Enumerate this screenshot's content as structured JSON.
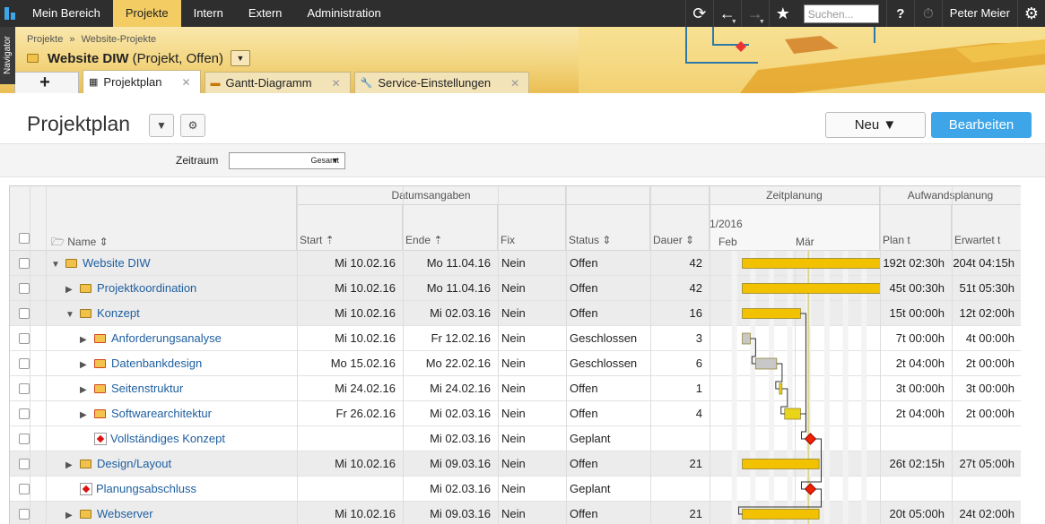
{
  "topbar": {
    "menu": [
      "Mein Bereich",
      "Projekte",
      "Intern",
      "Extern",
      "Administration"
    ],
    "active_index": 1,
    "search_placeholder": "Suchen...",
    "user": "Peter Meier"
  },
  "navigator_label": "Navigator",
  "breadcrumb": {
    "items": [
      "Projekte",
      "Website-Projekte"
    ],
    "sep": "»"
  },
  "project": {
    "name": "Website DIW",
    "meta": "(Projekt, Offen)"
  },
  "tabs": [
    {
      "label": "Projektplan",
      "active": true
    },
    {
      "label": "Gantt-Diagramm",
      "active": false
    },
    {
      "label": "Service-Einstellungen",
      "active": false
    }
  ],
  "page": {
    "title": "Projektplan",
    "new_label": "Neu",
    "edit_label": "Bearbeiten"
  },
  "filter": {
    "label": "Zeitraum",
    "value": "Gesamt"
  },
  "groups": {
    "dates": "Datumsangaben",
    "timeline": "Zeitplanung",
    "effort": "Aufwandsplanung"
  },
  "columns": {
    "name": "Name",
    "start": "Start",
    "end": "Ende",
    "fix": "Fix",
    "status": "Status",
    "duration": "Dauer",
    "plan": "Plan t",
    "expected": "Erwartet t"
  },
  "timeline": {
    "year": "1/2016",
    "months": [
      "Feb",
      "Mär"
    ]
  },
  "colors": {
    "accent": "#3ea6e8",
    "bar": "#f2c200",
    "header_gold": "#f3d57f",
    "link": "#1f5fa0"
  },
  "rows": [
    {
      "indent": 0,
      "expand": "down",
      "icon": "folder",
      "name": "Website DIW",
      "start": "Mi 10.02.16",
      "end": "Mo 11.04.16",
      "fix": "Nein",
      "status": "Offen",
      "duration": "42",
      "plan": "192t 02:30h",
      "expected": "204t 04:15h",
      "grey": true
    },
    {
      "indent": 1,
      "expand": "right",
      "icon": "folder",
      "name": "Projektkoordination",
      "start": "Mi 10.02.16",
      "end": "Mo 11.04.16",
      "fix": "Nein",
      "status": "Offen",
      "duration": "42",
      "plan": "45t 00:30h",
      "expected": "51t 05:30h",
      "grey": true
    },
    {
      "indent": 1,
      "expand": "down",
      "icon": "folder",
      "name": "Konzept",
      "start": "Mi 10.02.16",
      "end": "Mi 02.03.16",
      "fix": "Nein",
      "status": "Offen",
      "duration": "16",
      "plan": "15t 00:00h",
      "expected": "12t 02:00h",
      "grey": true
    },
    {
      "indent": 2,
      "expand": "right",
      "icon": "task",
      "name": "Anforderungsanalyse",
      "start": "Mi 10.02.16",
      "end": "Fr 12.02.16",
      "fix": "Nein",
      "status": "Geschlossen",
      "duration": "3",
      "plan": "7t 00:00h",
      "expected": "4t 00:00h",
      "grey": false
    },
    {
      "indent": 2,
      "expand": "right",
      "icon": "task",
      "name": "Datenbankdesign",
      "start": "Mo 15.02.16",
      "end": "Mo 22.02.16",
      "fix": "Nein",
      "status": "Geschlossen",
      "duration": "6",
      "plan": "2t 04:00h",
      "expected": "2t 00:00h",
      "grey": false
    },
    {
      "indent": 2,
      "expand": "right",
      "icon": "task",
      "name": "Seitenstruktur",
      "start": "Mi 24.02.16",
      "end": "Mi 24.02.16",
      "fix": "Nein",
      "status": "Offen",
      "duration": "1",
      "plan": "3t 00:00h",
      "expected": "3t 00:00h",
      "grey": false
    },
    {
      "indent": 2,
      "expand": "right",
      "icon": "task",
      "name": "Softwarearchitektur",
      "start": "Fr 26.02.16",
      "end": "Mi 02.03.16",
      "fix": "Nein",
      "status": "Offen",
      "duration": "4",
      "plan": "2t 04:00h",
      "expected": "2t 00:00h",
      "grey": false
    },
    {
      "indent": 2,
      "expand": "none",
      "icon": "milestone",
      "name": "Vollständiges Konzept",
      "start": "",
      "end": "Mi 02.03.16",
      "fix": "Nein",
      "status": "Geplant",
      "duration": "",
      "plan": "",
      "expected": "",
      "grey": false
    },
    {
      "indent": 1,
      "expand": "right",
      "icon": "folder",
      "name": "Design/Layout",
      "start": "Mi 10.02.16",
      "end": "Mi 09.03.16",
      "fix": "Nein",
      "status": "Offen",
      "duration": "21",
      "plan": "26t 02:15h",
      "expected": "27t 05:00h",
      "grey": true
    },
    {
      "indent": 1,
      "expand": "none",
      "icon": "milestone",
      "name": "Planungsabschluss",
      "start": "",
      "end": "Mi 02.03.16",
      "fix": "Nein",
      "status": "Geplant",
      "duration": "",
      "plan": "",
      "expected": "",
      "grey": false
    },
    {
      "indent": 1,
      "expand": "right",
      "icon": "folder",
      "name": "Webserver",
      "start": "Mi 10.02.16",
      "end": "Mi 09.03.16",
      "fix": "Nein",
      "status": "Offen",
      "duration": "21",
      "plan": "20t 05:00h",
      "expected": "24t 02:00h",
      "grey": true
    }
  ]
}
